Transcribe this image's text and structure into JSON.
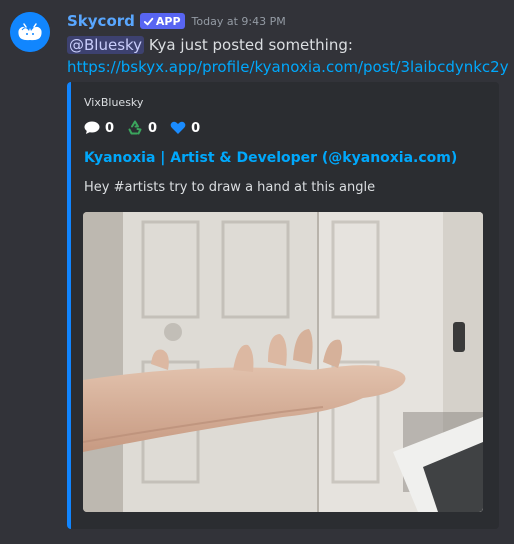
{
  "message": {
    "author": "Skycord",
    "badge": "APP",
    "timestamp": "Today at 9:43 PM",
    "mention": "@Bluesky",
    "text": " Kya just posted something:",
    "link": "https://bskyx.app/profile/kyanoxia.com/post/3laibcdynkc2y"
  },
  "embed": {
    "provider": "VixBluesky",
    "stats": {
      "replies": "0",
      "reposts": "0",
      "likes": "0"
    },
    "title": "Kyanoxia | Artist & Developer (@kyanoxia.com)",
    "description": "Hey #artists try to draw a hand at this angle",
    "image_alt": "photo of an outstretched hand in front of a white door"
  },
  "colors": {
    "background": "#323339",
    "embed_background": "#2b2d31",
    "embed_accent": "#1185fe",
    "username": "#59a7ff",
    "link": "#00a8fc",
    "badge": "#5865f2"
  },
  "icons": {
    "avatar": "butterfly-cloud-avatar-icon",
    "badge_check": "checkmark-icon",
    "replies": "speech-bubble-icon",
    "reposts": "recycle-icon",
    "likes": "heart-icon"
  }
}
